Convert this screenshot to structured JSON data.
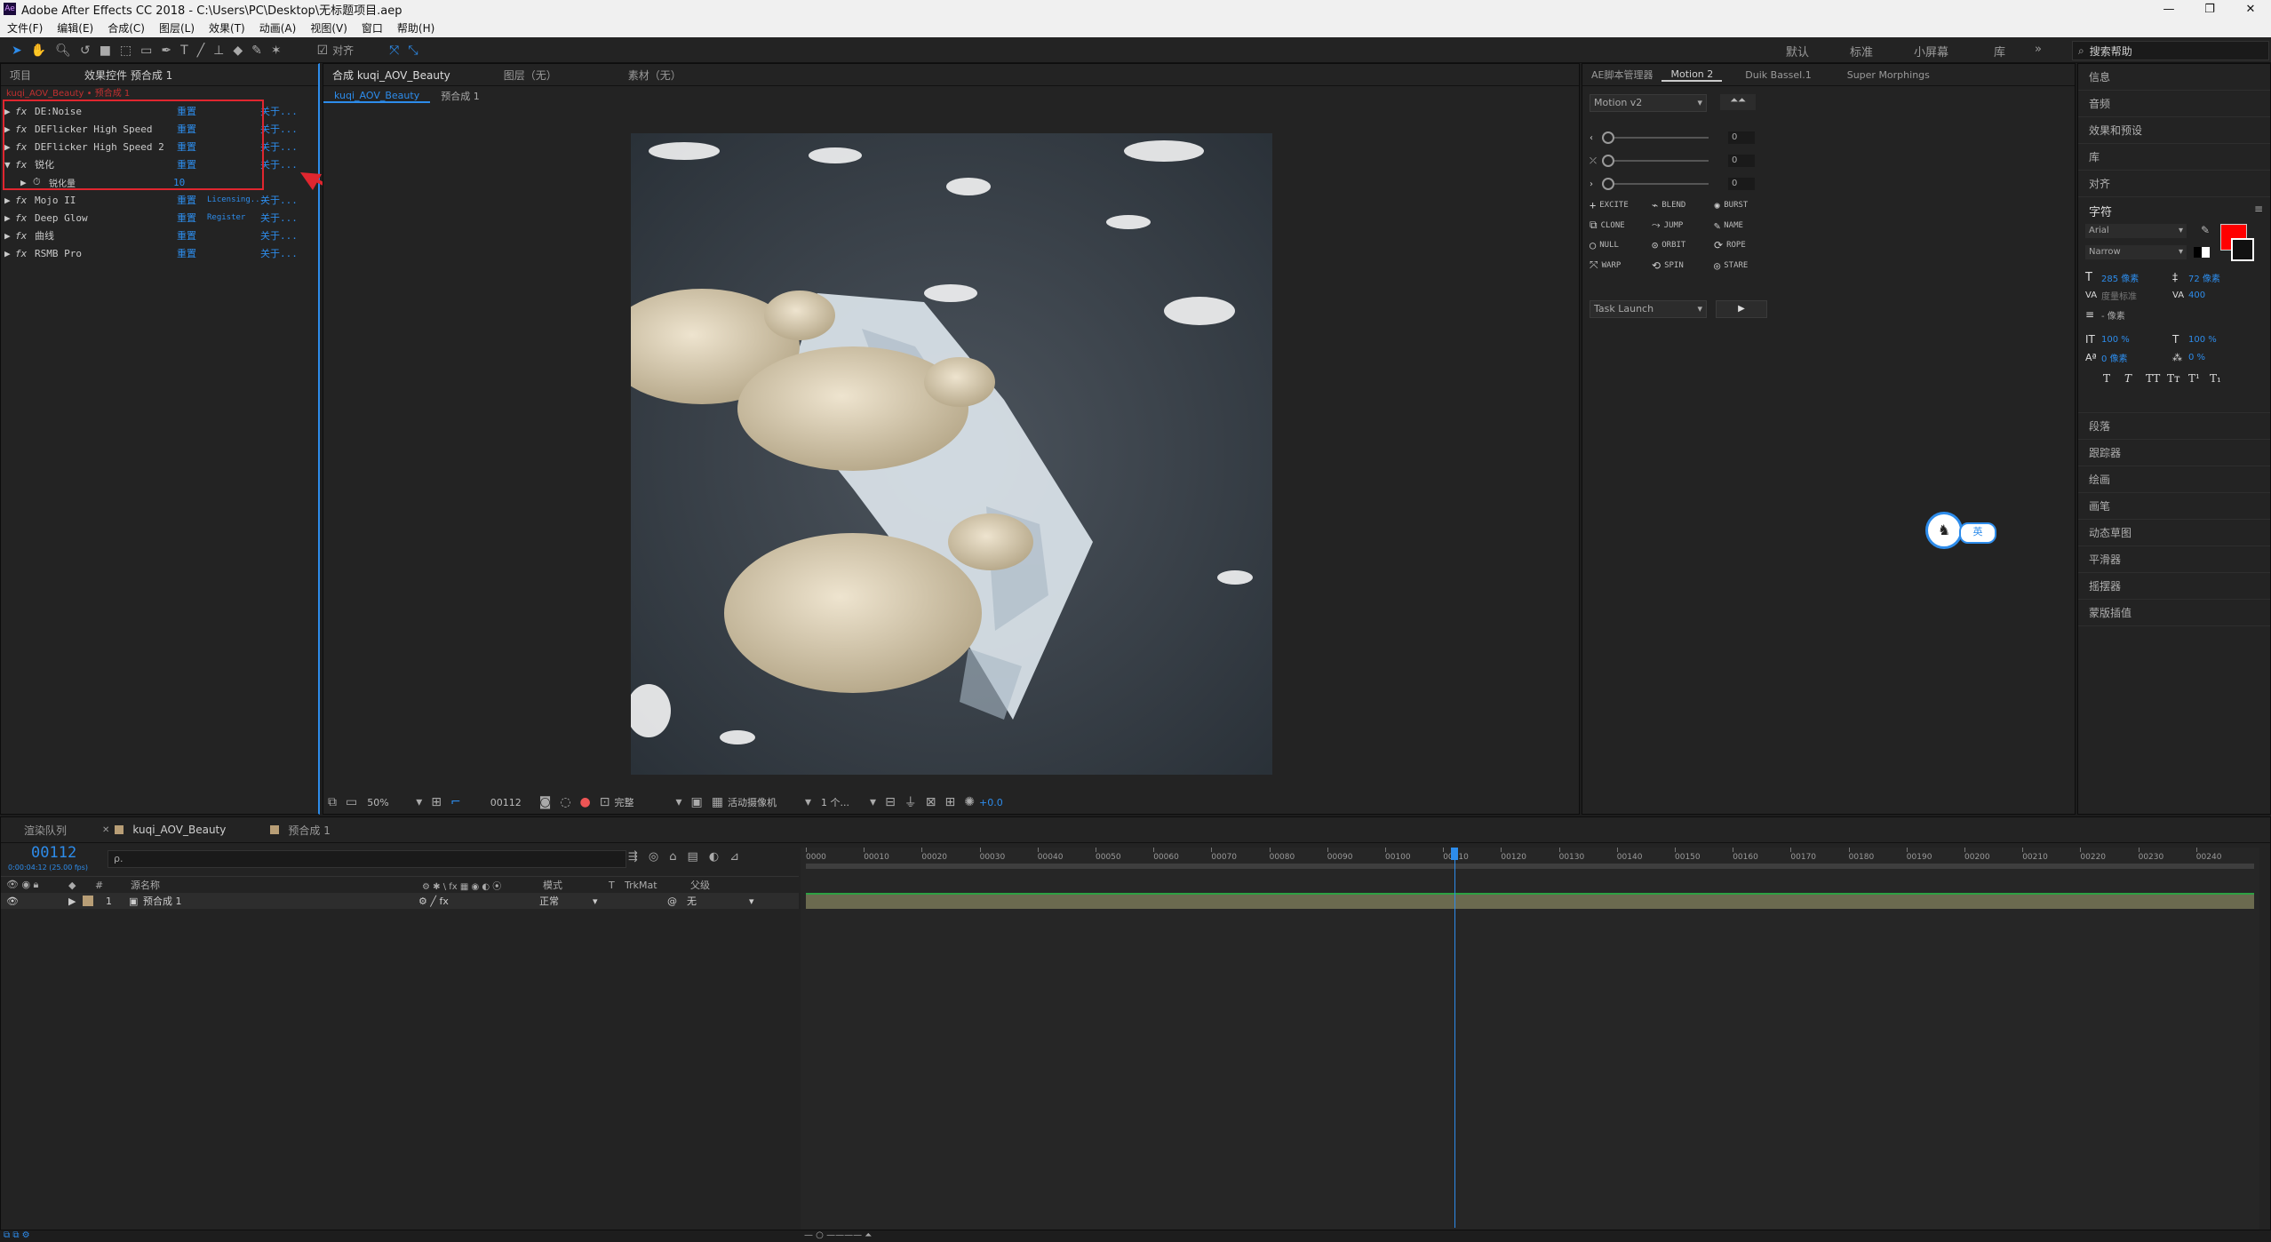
{
  "titlebar": {
    "title": "Adobe After Effects CC 2018 - C:\\Users\\PC\\Desktop\\无标题项目.aep",
    "min": "—",
    "restore": "❐",
    "close": "✕"
  },
  "menu": [
    "文件(F)",
    "编辑(E)",
    "合成(C)",
    "图层(L)",
    "效果(T)",
    "动画(A)",
    "视图(V)",
    "窗口",
    "帮助(H)"
  ],
  "toolbar": {
    "snap_label": "对齐",
    "workspaces": [
      "默认",
      "标准",
      "小屏幕",
      "库"
    ],
    "more": "»",
    "search_placeholder": "搜索帮助"
  },
  "left_panel": {
    "tabs": [
      "项目",
      "效果控件 预合成 1"
    ],
    "breadcrumb": "kuqi_AOV_Beauty • 预合成 1",
    "effects": [
      {
        "name": "DE:Noise",
        "reset": "重置",
        "about": "关于..."
      },
      {
        "name": "DEFlicker High Speed",
        "reset": "重置",
        "about": "关于..."
      },
      {
        "name": "DEFlicker High Speed 2",
        "reset": "重置",
        "about": "关于..."
      },
      {
        "name": "锐化",
        "reset": "重置",
        "about": "关于..."
      },
      {
        "name": "Mojo II",
        "reset": "重置",
        "extra": "Licensing...",
        "about": "关于..."
      },
      {
        "name": "Deep Glow",
        "reset": "重置",
        "extra": "Register",
        "about": "关于..."
      },
      {
        "name": "曲线",
        "reset": "重置",
        "about": "关于..."
      },
      {
        "name": "RSMB Pro",
        "reset": "重置",
        "about": "关于..."
      }
    ],
    "sharpen_param": {
      "label": "锐化量",
      "value": "10"
    }
  },
  "comp_panel": {
    "tabs": [
      "合成 kuqi_AOV_Beauty",
      "图层（无）",
      "素材（无）"
    ],
    "subtabs": [
      "kuqi_AOV_Beauty",
      "预合成 1"
    ],
    "bottom": {
      "zoom": "50%",
      "timecode": "00112",
      "quality": "完整",
      "camera": "活动摄像机",
      "views": "1 个...",
      "exposure": "+0.0"
    }
  },
  "right_panel": {
    "tabs": [
      "AE脚本管理器",
      "Motion 2",
      "Duik Bassel.1",
      "Super Morphings"
    ],
    "preset": "Motion v2",
    "sliders": [
      "0",
      "0",
      "0"
    ],
    "buttons": [
      "EXCITE",
      "BLEND",
      "BURST",
      "CLONE",
      "JUMP",
      "NAME",
      "NULL",
      "ORBIT",
      "ROPE",
      "WARP",
      "SPIN",
      "STARE"
    ],
    "task": "Task Launch",
    "task_btn": "▶",
    "ime_badge": "英"
  },
  "side_panels": {
    "items_top": [
      "信息",
      "音频",
      "效果和预设",
      "库",
      "对齐"
    ],
    "character": {
      "title": "字符",
      "font": "Arial",
      "style": "Narrow",
      "size": "285 像素",
      "leading": "72 像素",
      "kerning": "度量标准",
      "tracking": "400",
      "stroke_unit": "- 像素",
      "vscale": "100 %",
      "hscale": "100 %",
      "baseline": "0 像素",
      "tsume": "0 %",
      "styles": [
        "T",
        "T",
        "TT",
        "Tт",
        "T¹",
        "T₁"
      ],
      "fill_color": "#ff0000"
    },
    "items_bottom": [
      "段落",
      "跟踪器",
      "绘画",
      "画笔",
      "动态草图",
      "平滑器",
      "摇摆器",
      "蒙版插值"
    ]
  },
  "timeline": {
    "tabs": [
      "渲染队列",
      "kuqi_AOV_Beauty",
      "预合成 1"
    ],
    "timecode": "00112",
    "timecode_sub": "0:00:04:12 (25.00 fps)",
    "search_placeholder": "ρ.",
    "col_name": "源名称",
    "col_mode": "模式",
    "col_t": "T",
    "col_trkmat": "TrkMat",
    "col_parent": "父级",
    "layer": {
      "num": "1",
      "name": "预合成 1",
      "mode": "正常",
      "parent": "无"
    },
    "ruler": [
      "0000",
      "00010",
      "00020",
      "00030",
      "00040",
      "00050",
      "00060",
      "00070",
      "00080",
      "00090",
      "00100",
      "00110",
      "00120",
      "00130",
      "00140",
      "00150",
      "00160",
      "00170",
      "00180",
      "00190",
      "00200",
      "00210",
      "00220",
      "00230",
      "00240"
    ],
    "playhead_frame": 112,
    "frame_max": 250
  },
  "colors": {
    "accent": "#2d8ceb",
    "highlight": "#e0262f",
    "fill": "#ff0000"
  }
}
